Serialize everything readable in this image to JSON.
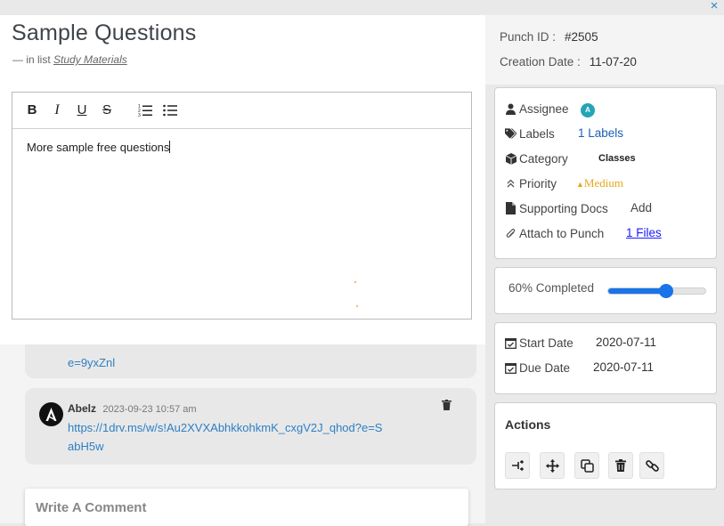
{
  "window": {
    "close_label": "×"
  },
  "card": {
    "title": "Sample Questions",
    "list_prefix": "—  in list",
    "list_name": "Study Materials"
  },
  "editor": {
    "content": "More sample free questions",
    "toolbar": [
      {
        "name": "bold",
        "glyph": "B"
      },
      {
        "name": "italic",
        "glyph": "I"
      },
      {
        "name": "underline",
        "glyph": "U"
      },
      {
        "name": "strikethrough",
        "glyph": "S"
      },
      {
        "name": "ordered-list",
        "glyph": "ordered-list-icon"
      },
      {
        "name": "bullet-list",
        "glyph": "bullet-list-icon"
      }
    ]
  },
  "comments": [
    {
      "link_partial": "e=9yxZnl"
    },
    {
      "author": "Abelz",
      "time": "2023-09-23 10:57 am",
      "link": "https://1drv.ms/w/s!Au2XVXAbhkkohkmK_cxgV2J_qhod?e=SabH5w"
    }
  ],
  "comment_input": {
    "placeholder": "Write A Comment"
  },
  "meta": {
    "punch_id_label": "Punch ID :",
    "punch_id": "#2505",
    "created_label": "Creation Date :",
    "created": "11-07-20"
  },
  "props": {
    "assignee_label": "Assignee",
    "assignee_initial": "A",
    "labels_label": "Labels",
    "labels_value": "1 Labels",
    "category_label": "Category",
    "category_value": "Classes",
    "priority_label": "Priority",
    "priority_value": "Medium",
    "docs_label": "Supporting Docs",
    "docs_action": "Add",
    "attach_label": "Attach to Punch",
    "attach_value": "1 Files"
  },
  "progress": {
    "label": "60% Completed",
    "fraction": 0.6
  },
  "dates": {
    "start_label": "Start Date",
    "start": "2020-07-11",
    "due_label": "Due Date",
    "due": "2020-07-11"
  },
  "actions": {
    "title": "Actions",
    "buttons": [
      "convert-icon",
      "move-icon",
      "copy-icon",
      "delete-icon",
      "link-icon"
    ]
  },
  "colors": {
    "accent": "#1a73e8",
    "link": "#2d7fc4",
    "priority": "#e6a817",
    "assignee_badge": "#24a5b6"
  }
}
